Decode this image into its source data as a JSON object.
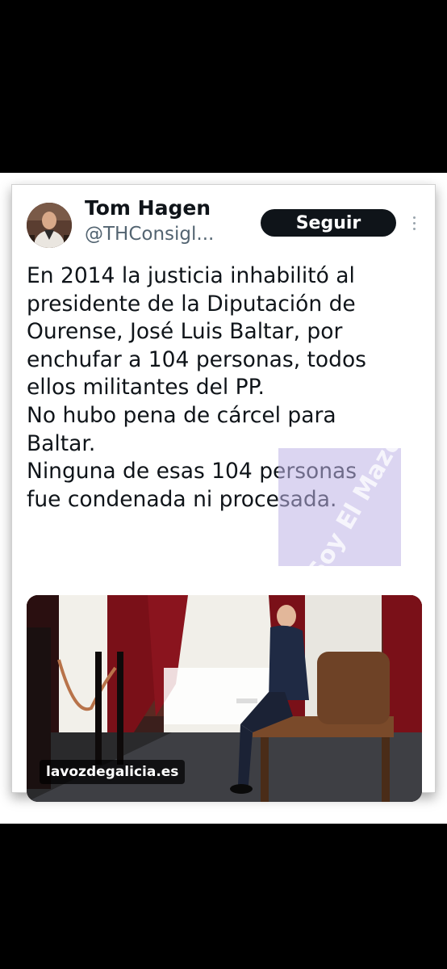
{
  "tweet": {
    "author_name": "Tom Hagen",
    "handle": "@THConsigl...",
    "follow_label": "Seguir",
    "text_lines": [
      "En 2014 la justicia inhabilitó al",
      "presidente de la Diputación de",
      "Ourense, José Luis Baltar, por",
      "enchufar a 104 personas, todos",
      "ellos militantes del PP.",
      "No hubo pena de cárcel para",
      "Baltar.",
      "Ninguna de esas 104 personas",
      "fue condenada ni procesada."
    ],
    "watermark_text": "Soy El Mazo",
    "media": {
      "source_label": "lavozdegalicia.es"
    }
  },
  "colors": {
    "text": "#0f1419",
    "secondary_text": "#536471",
    "follow_button_bg": "#0f1419",
    "background_outer": "#000000"
  },
  "icons": [
    "more-options-icon"
  ]
}
